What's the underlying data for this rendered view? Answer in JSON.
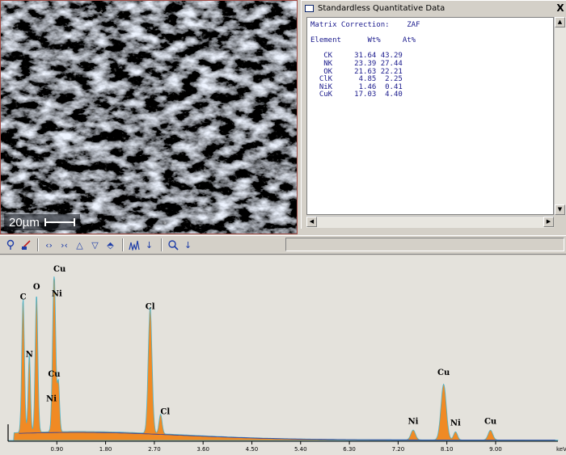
{
  "sem_image": {
    "scale_label": "20µm"
  },
  "quant_window": {
    "title": "Standardless Quantitative Data",
    "close_label": "X",
    "matrix_label": "Matrix Correction:",
    "matrix_value": "ZAF",
    "headers": [
      "Element",
      "Wt%",
      "At%"
    ],
    "rows": [
      {
        "element": "CK",
        "wt": "31.64",
        "at": "43.29"
      },
      {
        "element": "NK",
        "wt": "23.39",
        "at": "27.44"
      },
      {
        "element": "OK",
        "wt": "21.63",
        "at": "22.21"
      },
      {
        "element": "ClK",
        "wt": "4.85",
        "at": "2.25"
      },
      {
        "element": "NiK",
        "wt": "1.46",
        "at": "0.41"
      },
      {
        "element": "CuK",
        "wt": "17.03",
        "at": "4.40"
      }
    ]
  },
  "toolbar": {
    "icons": [
      "magnify-icon",
      "clear-icon",
      "expand-icon",
      "compress-icon",
      "peak-up-icon",
      "peak-down-icon",
      "label-icon",
      "spectrum-icon",
      "arrow-down-icon",
      "zoom-icon",
      "arrow-down-icon"
    ]
  },
  "chart_data": {
    "type": "area",
    "x_unit": "keV",
    "xlim": [
      0,
      10.15
    ],
    "ylim": [
      0,
      100
    ],
    "ticks": [
      "0.90",
      "1.80",
      "2.70",
      "3.60",
      "4.50",
      "5.40",
      "6.30",
      "7.20",
      "8.10",
      "9.00"
    ],
    "tick_values": [
      0.9,
      1.8,
      2.7,
      3.6,
      4.5,
      5.4,
      6.3,
      7.2,
      8.1,
      9.0
    ],
    "peaks": [
      {
        "x": 0.277,
        "y": 82,
        "w": 0.035
      },
      {
        "x": 0.392,
        "y": 48,
        "w": 0.03
      },
      {
        "x": 0.525,
        "y": 84,
        "w": 0.035
      },
      {
        "x": 0.85,
        "y": 98,
        "w": 0.04
      },
      {
        "x": 0.93,
        "y": 30,
        "w": 0.03
      },
      {
        "x": 2.622,
        "y": 77,
        "w": 0.05
      },
      {
        "x": 2.815,
        "y": 12,
        "w": 0.04
      },
      {
        "x": 7.478,
        "y": 6,
        "w": 0.06
      },
      {
        "x": 8.04,
        "y": 34,
        "w": 0.07
      },
      {
        "x": 8.26,
        "y": 5,
        "w": 0.05
      },
      {
        "x": 8.905,
        "y": 6,
        "w": 0.06
      }
    ],
    "labels": [
      {
        "text": "C",
        "x": 0.277,
        "y": 86
      },
      {
        "text": "N",
        "x": 0.392,
        "y": 51
      },
      {
        "text": "O",
        "x": 0.525,
        "y": 92
      },
      {
        "text": "Cu",
        "x": 0.95,
        "y": 103
      },
      {
        "text": "Ni",
        "x": 0.9,
        "y": 88
      },
      {
        "text": "Cu",
        "x": 0.85,
        "y": 39
      },
      {
        "text": "Ni",
        "x": 0.8,
        "y": 24
      },
      {
        "text": "Cl",
        "x": 2.622,
        "y": 80
      },
      {
        "text": "Cl",
        "x": 2.9,
        "y": 16
      },
      {
        "text": "Ni",
        "x": 7.478,
        "y": 10
      },
      {
        "text": "Cu",
        "x": 8.04,
        "y": 40
      },
      {
        "text": "Ni",
        "x": 8.26,
        "y": 9
      },
      {
        "text": "Cu",
        "x": 8.905,
        "y": 10
      }
    ],
    "fill_color": "#f08a24",
    "outline_color": "#4fb3c8"
  }
}
